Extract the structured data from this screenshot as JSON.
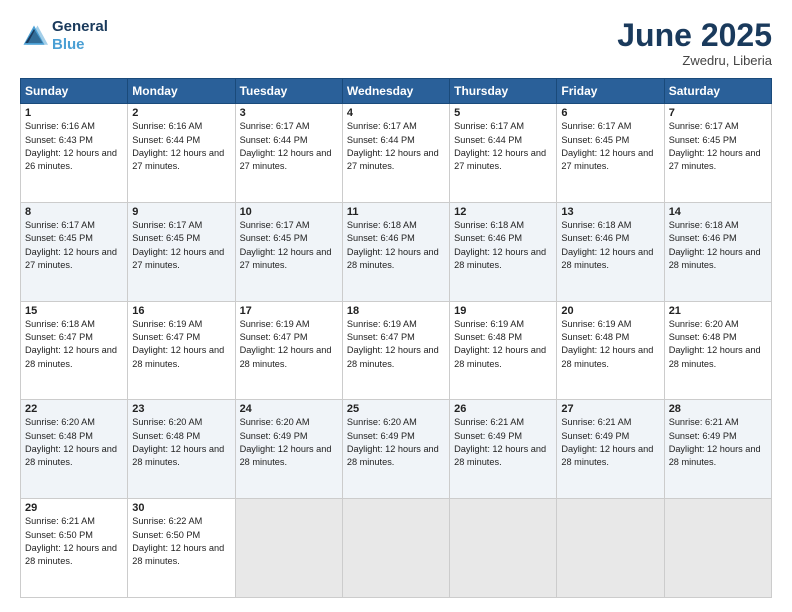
{
  "header": {
    "logo_line1": "General",
    "logo_line2": "Blue",
    "month": "June 2025",
    "location": "Zwedru, Liberia"
  },
  "days_of_week": [
    "Sunday",
    "Monday",
    "Tuesday",
    "Wednesday",
    "Thursday",
    "Friday",
    "Saturday"
  ],
  "weeks": [
    [
      {
        "day": 1,
        "sunrise": "6:16 AM",
        "sunset": "6:43 PM",
        "daylight": "12 hours and 26 minutes."
      },
      {
        "day": 2,
        "sunrise": "6:16 AM",
        "sunset": "6:44 PM",
        "daylight": "12 hours and 27 minutes."
      },
      {
        "day": 3,
        "sunrise": "6:17 AM",
        "sunset": "6:44 PM",
        "daylight": "12 hours and 27 minutes."
      },
      {
        "day": 4,
        "sunrise": "6:17 AM",
        "sunset": "6:44 PM",
        "daylight": "12 hours and 27 minutes."
      },
      {
        "day": 5,
        "sunrise": "6:17 AM",
        "sunset": "6:44 PM",
        "daylight": "12 hours and 27 minutes."
      },
      {
        "day": 6,
        "sunrise": "6:17 AM",
        "sunset": "6:45 PM",
        "daylight": "12 hours and 27 minutes."
      },
      {
        "day": 7,
        "sunrise": "6:17 AM",
        "sunset": "6:45 PM",
        "daylight": "12 hours and 27 minutes."
      }
    ],
    [
      {
        "day": 8,
        "sunrise": "6:17 AM",
        "sunset": "6:45 PM",
        "daylight": "12 hours and 27 minutes."
      },
      {
        "day": 9,
        "sunrise": "6:17 AM",
        "sunset": "6:45 PM",
        "daylight": "12 hours and 27 minutes."
      },
      {
        "day": 10,
        "sunrise": "6:17 AM",
        "sunset": "6:45 PM",
        "daylight": "12 hours and 27 minutes."
      },
      {
        "day": 11,
        "sunrise": "6:18 AM",
        "sunset": "6:46 PM",
        "daylight": "12 hours and 28 minutes."
      },
      {
        "day": 12,
        "sunrise": "6:18 AM",
        "sunset": "6:46 PM",
        "daylight": "12 hours and 28 minutes."
      },
      {
        "day": 13,
        "sunrise": "6:18 AM",
        "sunset": "6:46 PM",
        "daylight": "12 hours and 28 minutes."
      },
      {
        "day": 14,
        "sunrise": "6:18 AM",
        "sunset": "6:46 PM",
        "daylight": "12 hours and 28 minutes."
      }
    ],
    [
      {
        "day": 15,
        "sunrise": "6:18 AM",
        "sunset": "6:47 PM",
        "daylight": "12 hours and 28 minutes."
      },
      {
        "day": 16,
        "sunrise": "6:19 AM",
        "sunset": "6:47 PM",
        "daylight": "12 hours and 28 minutes."
      },
      {
        "day": 17,
        "sunrise": "6:19 AM",
        "sunset": "6:47 PM",
        "daylight": "12 hours and 28 minutes."
      },
      {
        "day": 18,
        "sunrise": "6:19 AM",
        "sunset": "6:47 PM",
        "daylight": "12 hours and 28 minutes."
      },
      {
        "day": 19,
        "sunrise": "6:19 AM",
        "sunset": "6:48 PM",
        "daylight": "12 hours and 28 minutes."
      },
      {
        "day": 20,
        "sunrise": "6:19 AM",
        "sunset": "6:48 PM",
        "daylight": "12 hours and 28 minutes."
      },
      {
        "day": 21,
        "sunrise": "6:20 AM",
        "sunset": "6:48 PM",
        "daylight": "12 hours and 28 minutes."
      }
    ],
    [
      {
        "day": 22,
        "sunrise": "6:20 AM",
        "sunset": "6:48 PM",
        "daylight": "12 hours and 28 minutes."
      },
      {
        "day": 23,
        "sunrise": "6:20 AM",
        "sunset": "6:48 PM",
        "daylight": "12 hours and 28 minutes."
      },
      {
        "day": 24,
        "sunrise": "6:20 AM",
        "sunset": "6:49 PM",
        "daylight": "12 hours and 28 minutes."
      },
      {
        "day": 25,
        "sunrise": "6:20 AM",
        "sunset": "6:49 PM",
        "daylight": "12 hours and 28 minutes."
      },
      {
        "day": 26,
        "sunrise": "6:21 AM",
        "sunset": "6:49 PM",
        "daylight": "12 hours and 28 minutes."
      },
      {
        "day": 27,
        "sunrise": "6:21 AM",
        "sunset": "6:49 PM",
        "daylight": "12 hours and 28 minutes."
      },
      {
        "day": 28,
        "sunrise": "6:21 AM",
        "sunset": "6:49 PM",
        "daylight": "12 hours and 28 minutes."
      }
    ],
    [
      {
        "day": 29,
        "sunrise": "6:21 AM",
        "sunset": "6:50 PM",
        "daylight": "12 hours and 28 minutes."
      },
      {
        "day": 30,
        "sunrise": "6:22 AM",
        "sunset": "6:50 PM",
        "daylight": "12 hours and 28 minutes."
      },
      null,
      null,
      null,
      null,
      null
    ]
  ]
}
